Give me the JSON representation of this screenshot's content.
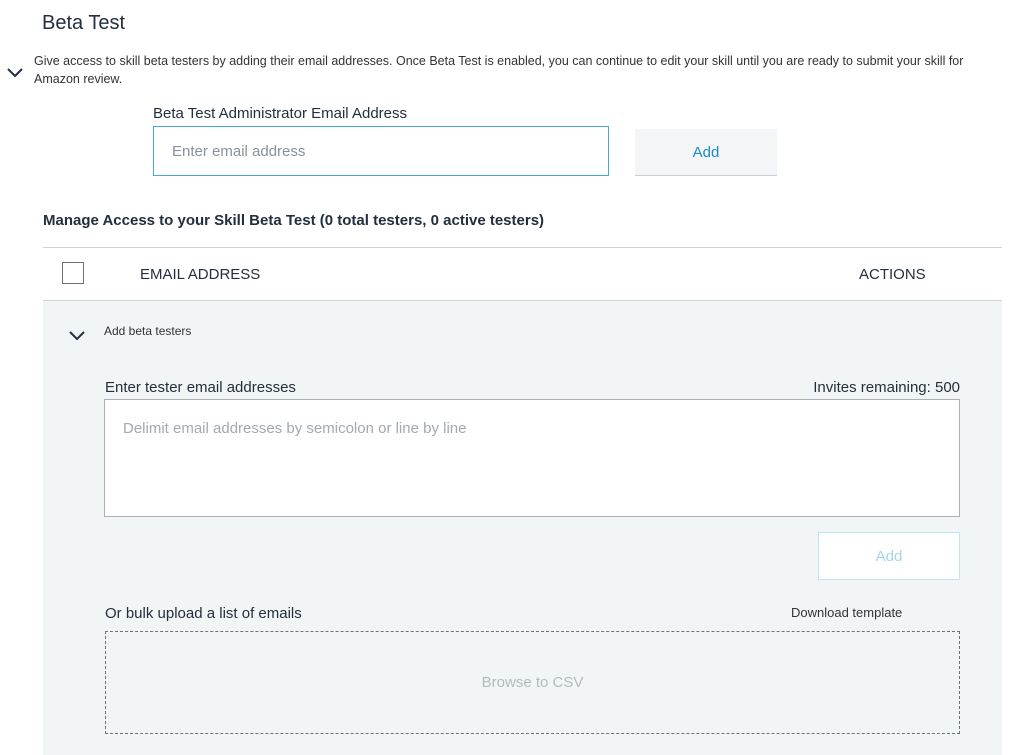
{
  "section": {
    "title": "Beta Test",
    "description": "Give access to skill beta testers by adding their email addresses. Once Beta Test is enabled, you can continue to edit your skill until you are ready to submit your skill for Amazon review.",
    "collapse_icon": "chevron-down-icon"
  },
  "admin": {
    "label": "Beta Test Administrator Email Address",
    "value": "",
    "placeholder": "Enter email address",
    "add_label": "Add"
  },
  "manage": {
    "heading": "Manage Access to your Skill Beta Test (0 total testers, 0 active testers)"
  },
  "table": {
    "columns": [
      "EMAIL ADDRESS",
      "ACTIONS"
    ],
    "select_all_checked": false
  },
  "add_testers": {
    "toggle_label": "Add beta testers",
    "toggle_icon": "chevron-down-icon",
    "input_label": "Enter tester email addresses",
    "invites_remaining": "Invites remaining: 500",
    "value": "",
    "placeholder": "Delimit email addresses by semicolon or line by line",
    "add_label": "Add",
    "bulk_label": "Or bulk upload a list of emails",
    "download_template": "Download template",
    "browse_label": "Browse to CSV"
  },
  "colors": {
    "accent": "#1a8ac7",
    "input_focus_border": "#4aa8d8",
    "panel_background": "#f2f5f6",
    "disabled_button_text": "#a3d5ec"
  }
}
